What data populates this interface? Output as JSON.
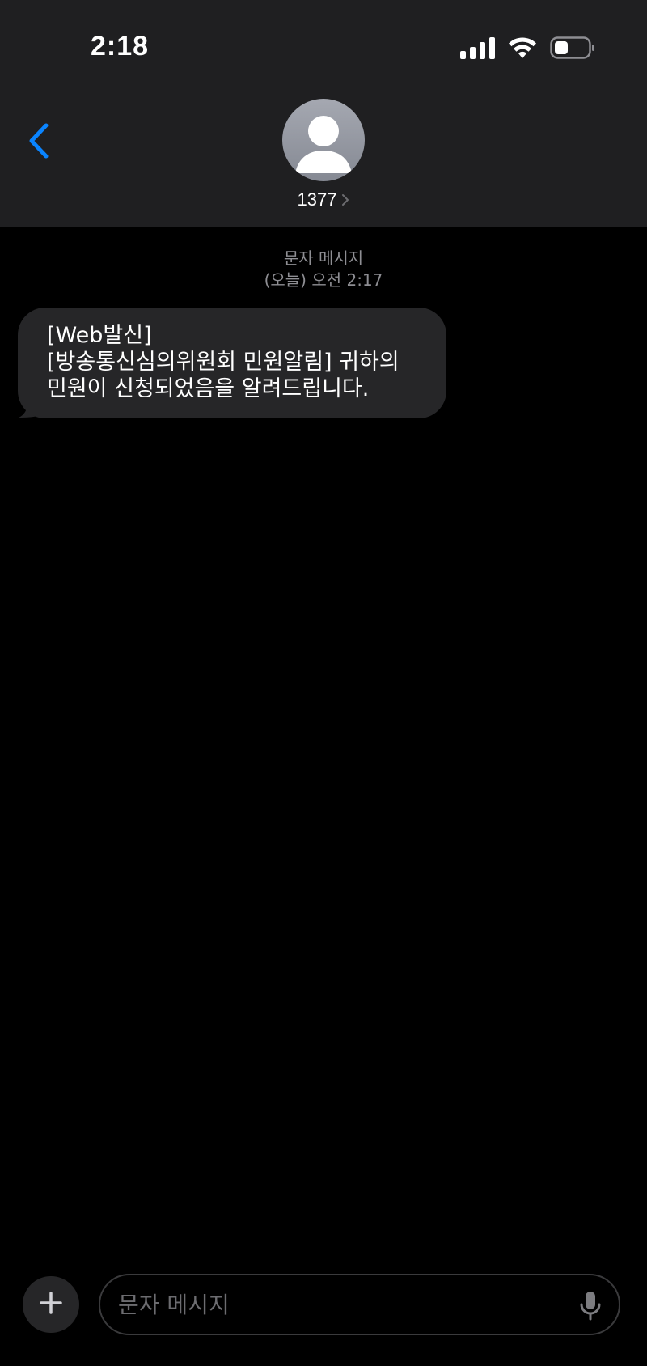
{
  "status_bar": {
    "time": "2:18",
    "icons": [
      "cellular-signal-icon",
      "wifi-icon",
      "battery-icon"
    ]
  },
  "header": {
    "back_icon": "chevron-left-icon",
    "contact_name": "1377",
    "avatar_icon": "person-icon"
  },
  "conversation": {
    "service_label": "문자 메시지",
    "timestamp": "(오늘) 오전 2:17",
    "messages": [
      {
        "direction": "incoming",
        "lines": [
          "[Web발신]",
          "[방송통신심의위원회 민원알림] 귀하의",
          "민원이 신청되었음을 알려드립니다."
        ]
      }
    ]
  },
  "input_bar": {
    "add_icon": "plus-icon",
    "placeholder": "문자 메시지",
    "value": "",
    "mic_icon": "microphone-icon"
  },
  "colors": {
    "accent": "#0a84ff",
    "header_bg": "#1f1f21",
    "bubble_incoming": "#262628",
    "secondary_text": "#8e8e93"
  }
}
